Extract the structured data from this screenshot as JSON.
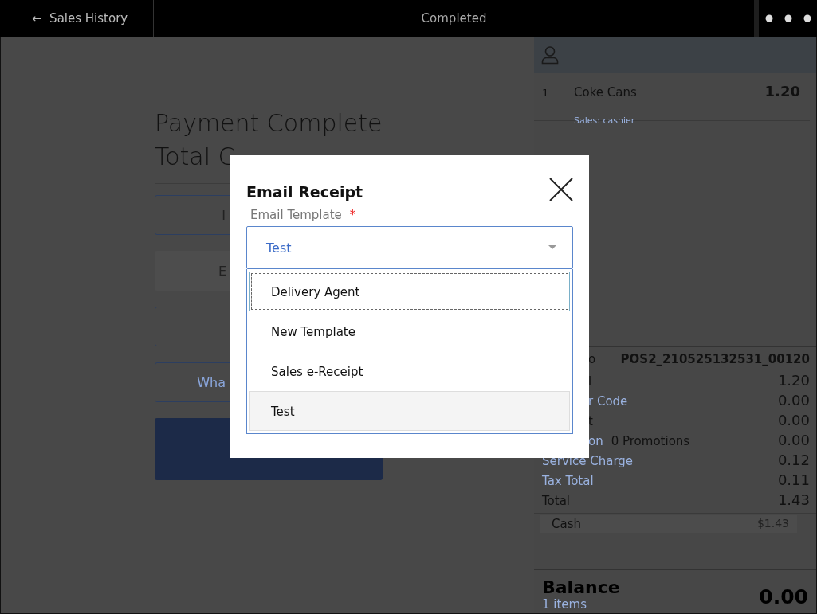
{
  "top_bar": {
    "back_label": "Sales History",
    "back_arrow": "←",
    "title": "Completed"
  },
  "main": {
    "heading": "Payment Complete",
    "subheading": "Total C",
    "buttons": [
      {
        "label": "I",
        "kind": "outline"
      },
      {
        "label": "E",
        "kind": "flat"
      },
      {
        "kind": "outline"
      },
      {
        "label": "Wha",
        "kind": "outline"
      },
      {
        "kind": "primary"
      }
    ]
  },
  "cart": {
    "items": [
      {
        "qty": "1",
        "name": "Coke Cans",
        "price": "1.20",
        "note": "Sales: cashier"
      }
    ],
    "summary": [
      {
        "label": "o",
        "value": "POS2_210525132531_00120",
        "link": false,
        "cut": true
      },
      {
        "label": "l",
        "value": "1.20",
        "link": false,
        "cut": true
      },
      {
        "label": "r Code",
        "value": "0.00",
        "link": true,
        "cut": true
      },
      {
        "label": "t",
        "value": "0.00",
        "link": false,
        "cut": true
      },
      {
        "label": "on",
        "extra": "0 Promotions",
        "value": "0.00",
        "link": true,
        "cut": true
      },
      {
        "label": "Service Charge",
        "value": "0.12",
        "link": true,
        "cut": false
      },
      {
        "label": "Tax Total",
        "value": "0.11",
        "link": true,
        "cut": false
      },
      {
        "label": "Total",
        "value": "1.43",
        "link": false,
        "cut": false
      }
    ],
    "payments": [
      {
        "method": "Cash",
        "amount": "$1.43"
      }
    ],
    "balance_label": "Balance",
    "items_count": "1 items",
    "balance": "0.00"
  },
  "dialog": {
    "title": "Email Receipt",
    "field_label": "Email Template",
    "required_mark": "*",
    "value": "Test",
    "options": [
      {
        "label": "Delivery Agent",
        "selected": false,
        "focused": true
      },
      {
        "label": "New Template",
        "selected": false,
        "focused": false
      },
      {
        "label": "Sales e-Receipt",
        "selected": false,
        "focused": false
      },
      {
        "label": "Test",
        "selected": true,
        "focused": false
      }
    ]
  }
}
